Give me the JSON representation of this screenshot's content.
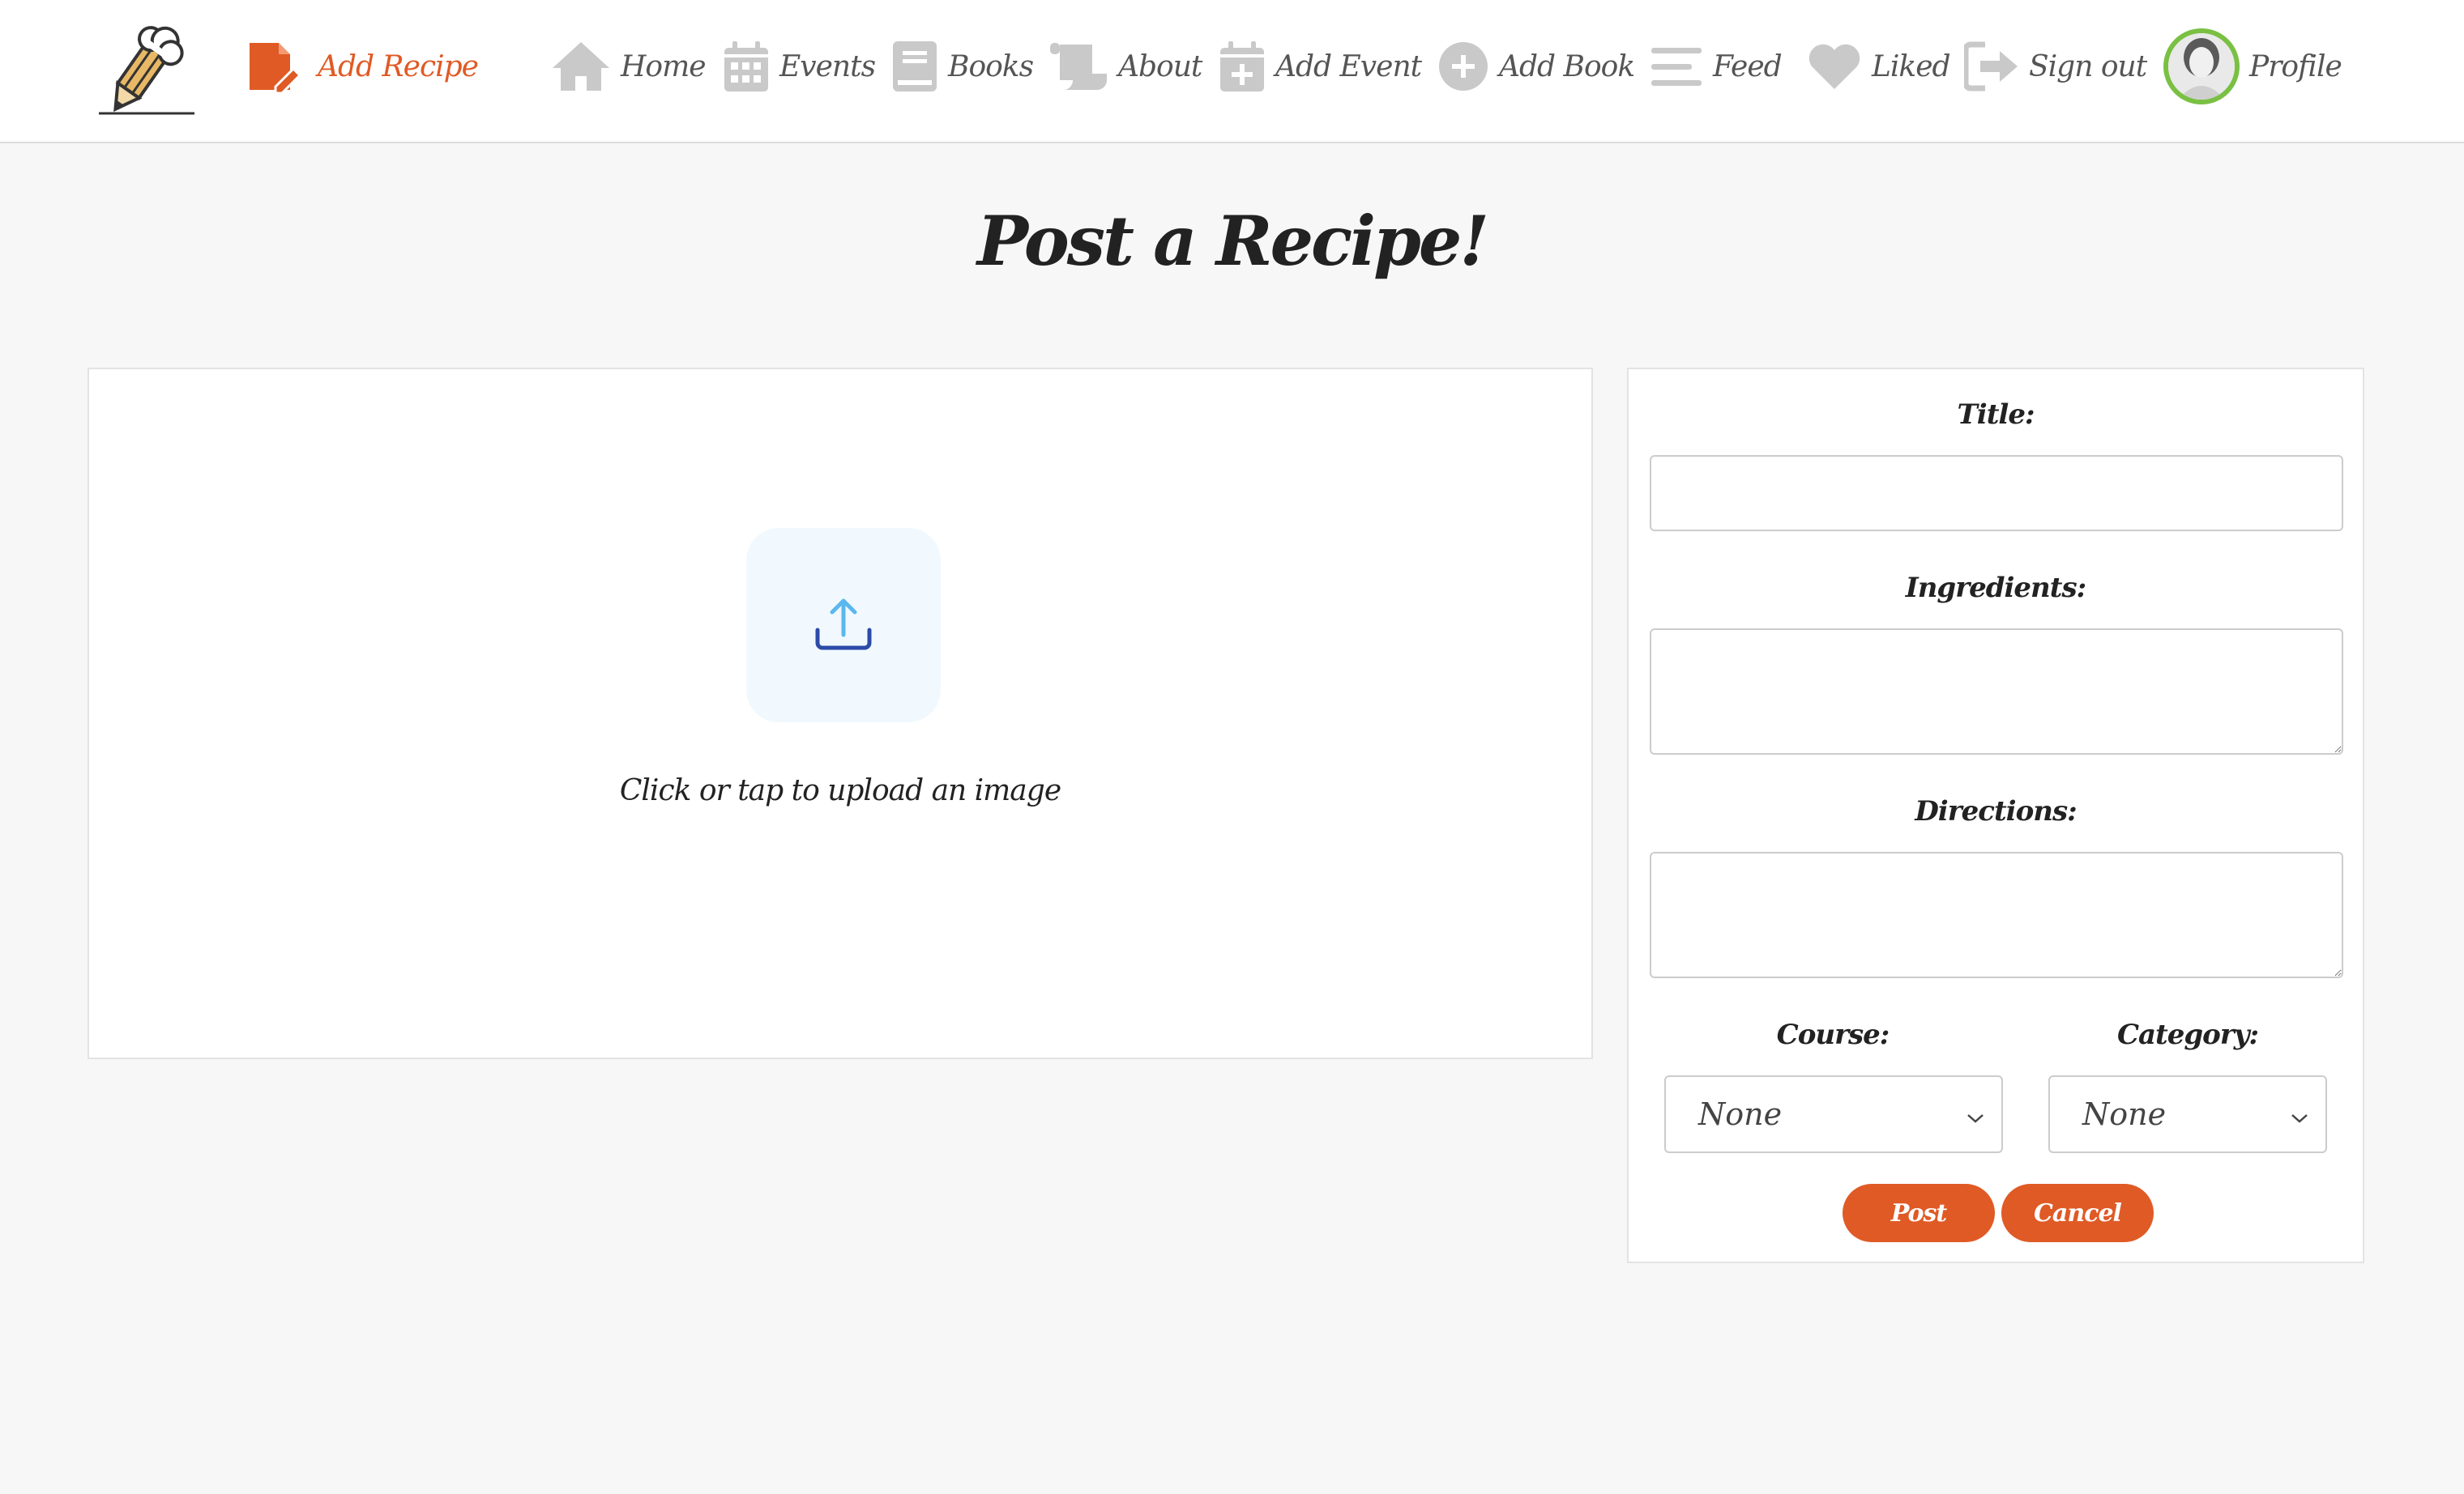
{
  "nav": {
    "items": [
      {
        "label": "Add Recipe",
        "icon": "add-recipe-icon",
        "active": true
      },
      {
        "label": "Home",
        "icon": "home-icon"
      },
      {
        "label": "Events",
        "icon": "calendar-icon"
      },
      {
        "label": "Books",
        "icon": "book-icon"
      },
      {
        "label": "About",
        "icon": "scroll-icon"
      },
      {
        "label": "Add Event",
        "icon": "calendar-plus-icon"
      },
      {
        "label": "Add Book",
        "icon": "plus-circle-icon"
      },
      {
        "label": "Feed",
        "icon": "feed-lines-icon"
      },
      {
        "label": "Liked",
        "icon": "heart-icon"
      },
      {
        "label": "Sign out",
        "icon": "sign-out-icon"
      },
      {
        "label": "Profile",
        "icon": "avatar"
      }
    ]
  },
  "page": {
    "title": "Post a Recipe!"
  },
  "upload": {
    "text": "Click or tap to upload an image",
    "icon": "upload-icon"
  },
  "form": {
    "title_label": "Title:",
    "title_value": "",
    "ingredients_label": "Ingredients:",
    "ingredients_value": "",
    "directions_label": "Directions:",
    "directions_value": "",
    "course_label": "Course:",
    "course_value": "None",
    "category_label": "Category:",
    "category_value": "None",
    "post_label": "Post",
    "cancel_label": "Cancel"
  },
  "colors": {
    "accent": "#e05a25",
    "nav_icon": "#c9c9c9",
    "nav_text": "#555555",
    "avatar_ring": "#7ac043",
    "background": "#f7f7f7"
  }
}
